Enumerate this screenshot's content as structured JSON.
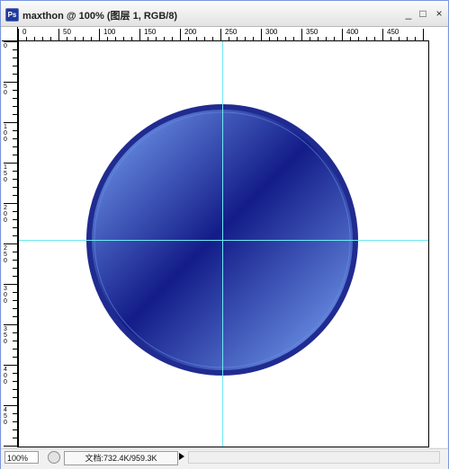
{
  "window": {
    "title": "maxthon @ 100% (图层 1, RGB/8)",
    "app_icon": "Ps",
    "buttons": {
      "minimize": "_",
      "maximize": "□",
      "close": "×"
    }
  },
  "ruler": {
    "top_ticks": [
      "0",
      "50",
      "100",
      "150",
      "200",
      "250",
      "300",
      "350",
      "400",
      "450"
    ],
    "left_ticks": [
      "0",
      "5\n0",
      "1\n0\n0",
      "1\n5\n0",
      "2\n0\n0",
      "2\n5\n0",
      "3\n0\n0",
      "3\n5\n0",
      "4\n0\n0",
      "4\n5\n0"
    ]
  },
  "canvas": {
    "colors": {
      "circle_border": "#202b90",
      "circle_light": "#7eaaf9",
      "circle_dark": "#131c88",
      "guide": "#6fe8f3"
    }
  },
  "status": {
    "zoom": "100%",
    "doc_info": "文档:732.4K/959.3K"
  }
}
